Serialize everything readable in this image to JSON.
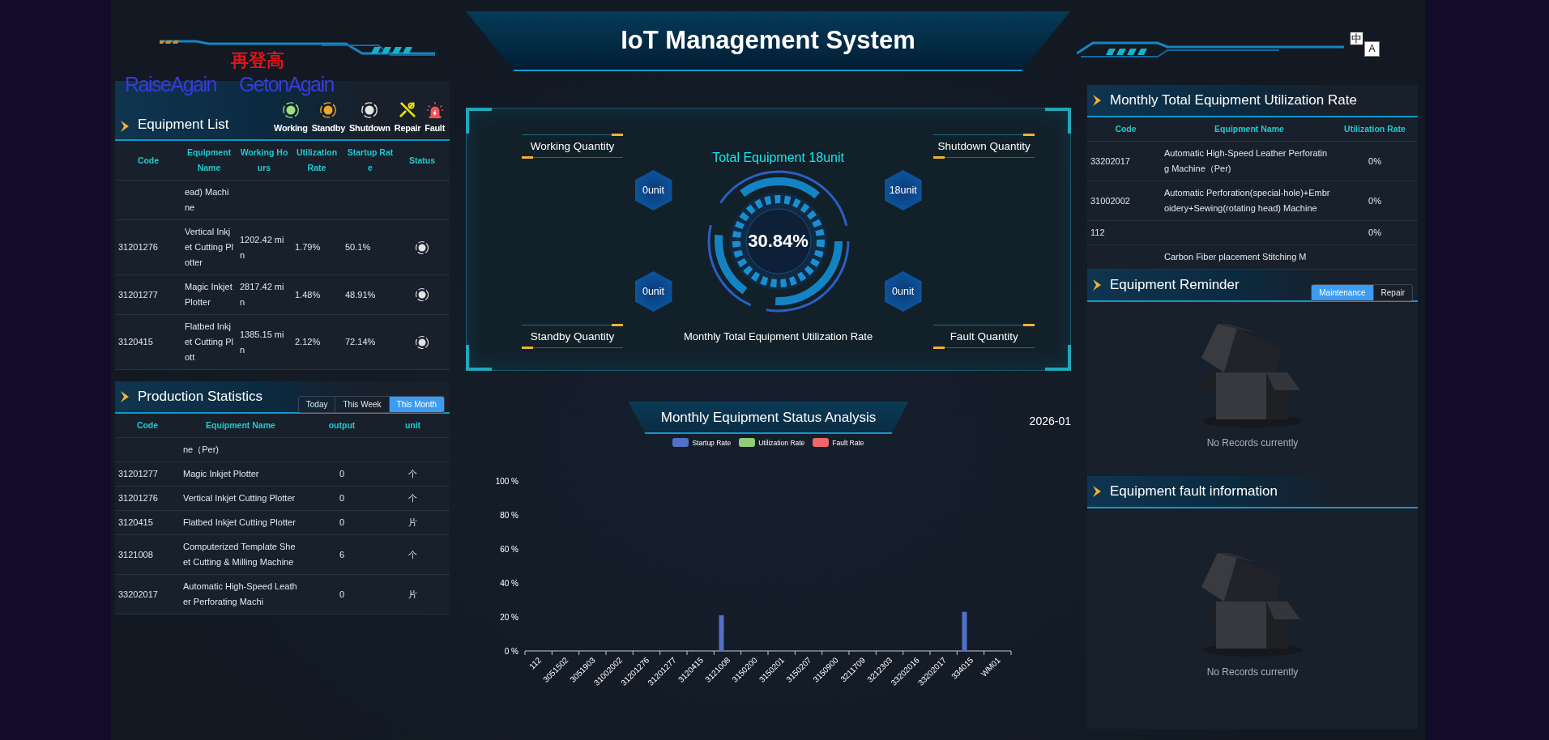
{
  "header": {
    "title": "IoT Management System",
    "logo": {
      "chinese": "再登高",
      "english": "RaiseAgain",
      "english_2": "GetonAgain"
    },
    "language_switch": [
      {
        "label": "中",
        "selected": true
      },
      {
        "label": "A",
        "selected": false
      }
    ]
  },
  "equipment_list": {
    "title": "Equipment List",
    "legend": [
      {
        "kind": "working",
        "label": "Working"
      },
      {
        "kind": "standby",
        "label": "Standby"
      },
      {
        "kind": "shutdown",
        "label": "Shutdown"
      },
      {
        "kind": "repair",
        "label": "Repair"
      },
      {
        "kind": "fault",
        "label": "Fault"
      }
    ],
    "columns": [
      "Code",
      "Equipment Name",
      "Working Hours",
      "Utilization Rate",
      "Startup Rate",
      "Status"
    ],
    "rows": [
      {
        "name": "ead) Machine"
      },
      {
        "code": "31201276",
        "name": "Vertical Inkjet Cutting Plotter",
        "hours": "1202.42 min",
        "utilization": "1.79%",
        "startup": "50.1%",
        "kind": "shutdown"
      },
      {
        "code": "31201277",
        "name": "Magic Inkjet Plotter",
        "hours": "2817.42 min",
        "utilization": "1.48%",
        "startup": "48.91%",
        "kind": "shutdown"
      },
      {
        "code": "3120415",
        "name": "Flatbed Inkjet Cutting Plott",
        "hours": "1385.15 min",
        "utilization": "2.12%",
        "startup": "72.14%",
        "kind": "shutdown"
      }
    ]
  },
  "production_statistics": {
    "title": "Production Statistics",
    "periods": [
      {
        "label": "Today",
        "selected": false
      },
      {
        "label": "This Week",
        "selected": false
      },
      {
        "label": "This Month",
        "selected": true
      }
    ],
    "columns": [
      "Code",
      "Equipment Name",
      "output",
      "unit"
    ],
    "rows": [
      {
        "name": "ne（Per)"
      },
      {
        "code": "31201277",
        "name": "Magic Inkjet Plotter",
        "output": "0",
        "unit": "个"
      },
      {
        "code": "31201276",
        "name": "Vertical Inkjet Cutting Plotter",
        "output": "0",
        "unit": "个"
      },
      {
        "code": "3120415",
        "name": "Flatbed Inkjet Cutting Plotter",
        "output": "0",
        "unit": "片"
      },
      {
        "code": "3121008",
        "name": "Computerized Template Sheet Cutting & Milling Machine",
        "output": "6",
        "unit": "个"
      },
      {
        "code": "33202017",
        "name": "Automatic High-Speed Leather Perforating Machi",
        "output": "0",
        "unit": "片"
      }
    ]
  },
  "overview": {
    "total": "Total Equipment 18unit",
    "rate": "30.84%",
    "caption": "Monthly Total Equipment Utilization Rate",
    "quantities": [
      {
        "label": "Working Quantity",
        "value": "0unit"
      },
      {
        "label": "Shutdown Quantity",
        "value": "18unit"
      },
      {
        "label": "Standby Quantity",
        "value": "0unit"
      },
      {
        "label": "Fault Quantity",
        "value": "0unit"
      }
    ]
  },
  "status_analysis": {
    "title": "Monthly Equipment Status Analysis",
    "month": "2026-01",
    "chart_data": {
      "type": "bar",
      "categories": [
        "112",
        "3051502",
        "3051903",
        "31002002",
        "31201276",
        "31201277",
        "3120415",
        "3121008",
        "3150200",
        "3150201",
        "3150207",
        "3150900",
        "3211709",
        "3212303",
        "33202016",
        "33202017",
        "334015",
        "WM01"
      ],
      "series": [
        {
          "name": "Startup Rate",
          "color": "#5470c6",
          "values": [
            0,
            0,
            0,
            0,
            0,
            0,
            0,
            21,
            0,
            0,
            0,
            0,
            0,
            0,
            0,
            0,
            23,
            0
          ]
        },
        {
          "name": "Utilization Rate",
          "color": "#91cc75",
          "values": [
            0,
            0,
            0,
            0,
            0,
            0,
            0,
            0,
            0,
            0,
            0,
            0,
            0,
            0,
            0,
            0,
            0,
            0
          ]
        },
        {
          "name": "Fault Rate",
          "color": "#ee6666",
          "values": [
            0,
            0,
            0,
            0,
            0,
            0,
            0,
            0,
            0,
            0,
            0,
            0,
            0,
            0,
            0,
            0,
            0,
            0
          ]
        }
      ],
      "ylim": [
        0,
        100
      ],
      "yticks": [
        {
          "value": 0,
          "label": "0 %"
        },
        {
          "value": 20,
          "label": "20 %"
        },
        {
          "value": 40,
          "label": "40 %"
        },
        {
          "value": 60,
          "label": "60 %"
        },
        {
          "value": 80,
          "label": "80 %"
        },
        {
          "value": 100,
          "label": "100 %"
        }
      ]
    }
  },
  "utilization": {
    "title": "Monthly Total Equipment Utilization Rate",
    "columns": [
      "Code",
      "Equipment Name",
      "Utilization Rate"
    ],
    "rows": [
      {
        "code": "33202017",
        "name": "Automatic High-Speed Leather Perforating Machine（Per)",
        "rate": "0%"
      },
      {
        "code": "31002002",
        "name": "Automatic Perforation(special-hole)+Embroidery+Sewing(rotating head) Machine",
        "rate": "0%"
      },
      {
        "code": "112",
        "rate": "0%"
      },
      {
        "name": "Carbon Fiber placement Stitching M"
      }
    ]
  },
  "reminder": {
    "title": "Equipment Reminder",
    "tabs": [
      {
        "label": "Maintenance",
        "selected": true
      },
      {
        "label": "Repair",
        "selected": false
      }
    ],
    "empty": "No Records currently"
  },
  "fault_info": {
    "title": "Equipment fault information",
    "empty": "No Records currently"
  }
}
